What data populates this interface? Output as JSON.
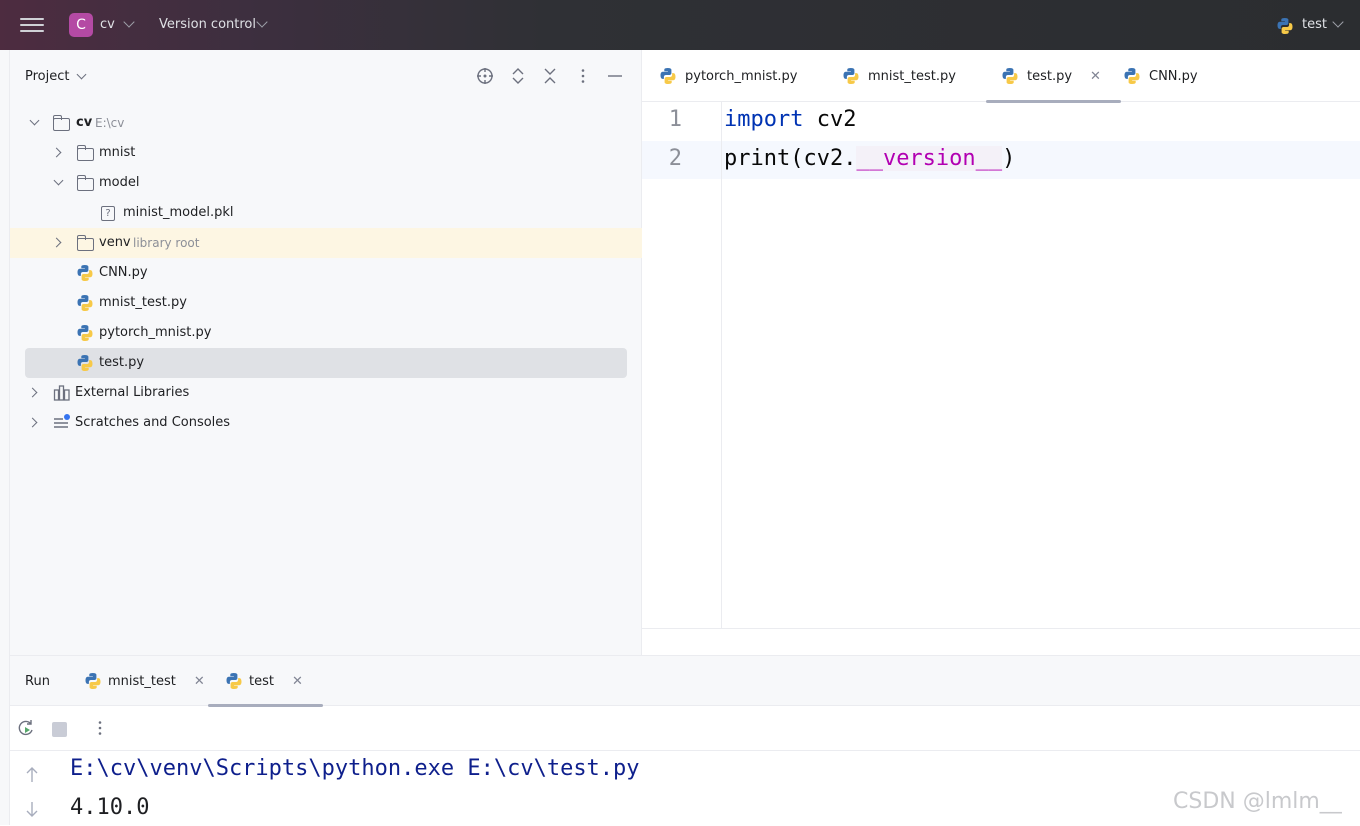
{
  "titlebar": {
    "project_badge": "C",
    "project_name": "cv",
    "version_control": "Version control",
    "run_config": "test"
  },
  "project_panel": {
    "title": "Project",
    "tree": [
      {
        "label": "cv",
        "hint": "E:\\cv"
      },
      {
        "label": "mnist"
      },
      {
        "label": "model"
      },
      {
        "label": "minist_model.pkl"
      },
      {
        "label": "venv",
        "hint": "library root"
      },
      {
        "label": "CNN.py"
      },
      {
        "label": "mnist_test.py"
      },
      {
        "label": "pytorch_mnist.py"
      },
      {
        "label": "test.py"
      },
      {
        "label": "External Libraries"
      },
      {
        "label": "Scratches and Consoles"
      }
    ]
  },
  "editor": {
    "tabs": [
      {
        "label": "pytorch_mnist.py"
      },
      {
        "label": "mnist_test.py"
      },
      {
        "label": "test.py",
        "active": true
      },
      {
        "label": "CNN.py"
      }
    ],
    "lines": [
      {
        "no": "1",
        "kw": "import",
        "rest": " cv2"
      },
      {
        "no": "2",
        "pre": "print(cv2.",
        "dunder": "__version__",
        "post": ")"
      }
    ]
  },
  "run_panel": {
    "title": "Run",
    "tabs": [
      {
        "label": "mnist_test"
      },
      {
        "label": "test",
        "active": true
      }
    ],
    "console": [
      "E:\\cv\\venv\\Scripts\\python.exe E:\\cv\\test.py",
      "4.10.0"
    ]
  },
  "watermark": "CSDN @lmlm__",
  "colors": {
    "python_blue": "#3b73b3",
    "python_yellow": "#f7c948",
    "project_badge": "#b44aa4",
    "keyword": "#0033b3",
    "dunder": "#b200b2"
  }
}
